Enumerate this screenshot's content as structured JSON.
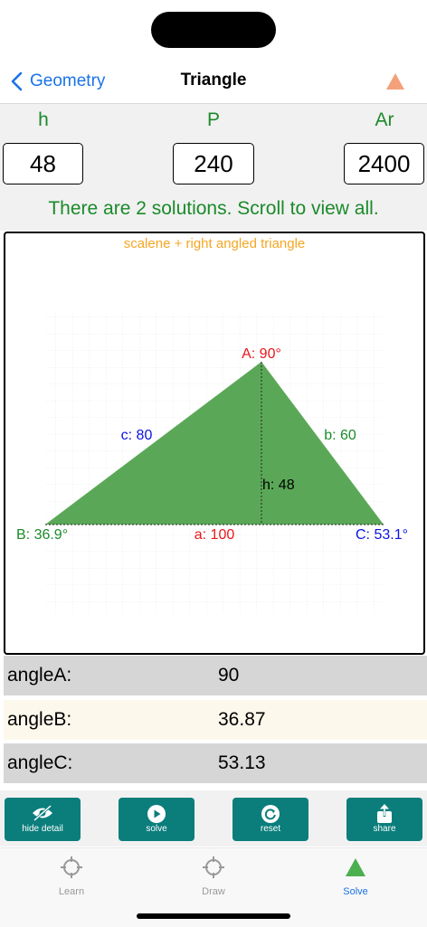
{
  "nav": {
    "back_label": "Geometry",
    "title": "Triangle"
  },
  "inputs": {
    "h_label": "h",
    "p_label": "P",
    "ar_label": "Ar",
    "h_value": "48",
    "p_value": "240",
    "ar_value": "2400",
    "message": "There are 2 solutions. Scroll to view all."
  },
  "diagram": {
    "type_label": "scalene + right angled triangle",
    "angle_a_label": "A: 90°",
    "angle_b_label": "B: 36.9°",
    "angle_c_label": "C: 53.1°",
    "side_a_label": "a: 100",
    "side_b_label": "b: 60",
    "side_c_label": "c: 80",
    "height_label": "h: 48"
  },
  "results": [
    {
      "key": "angleA:",
      "value": "90"
    },
    {
      "key": "angleB:",
      "value": "36.87"
    },
    {
      "key": "angleC:",
      "value": "53.13"
    }
  ],
  "actions": {
    "hide_detail": "hide detail",
    "solve": "solve",
    "reset": "reset",
    "share": "share"
  },
  "tabs": {
    "learn": "Learn",
    "draw": "Draw",
    "solve": "Solve"
  },
  "colors": {
    "accent_blue": "#1a73e8",
    "green": "#1b8a2a",
    "teal": "#0b7e7c",
    "triangle_fill": "#5aa857",
    "orange": "#f5a623",
    "red": "#e8161b"
  }
}
